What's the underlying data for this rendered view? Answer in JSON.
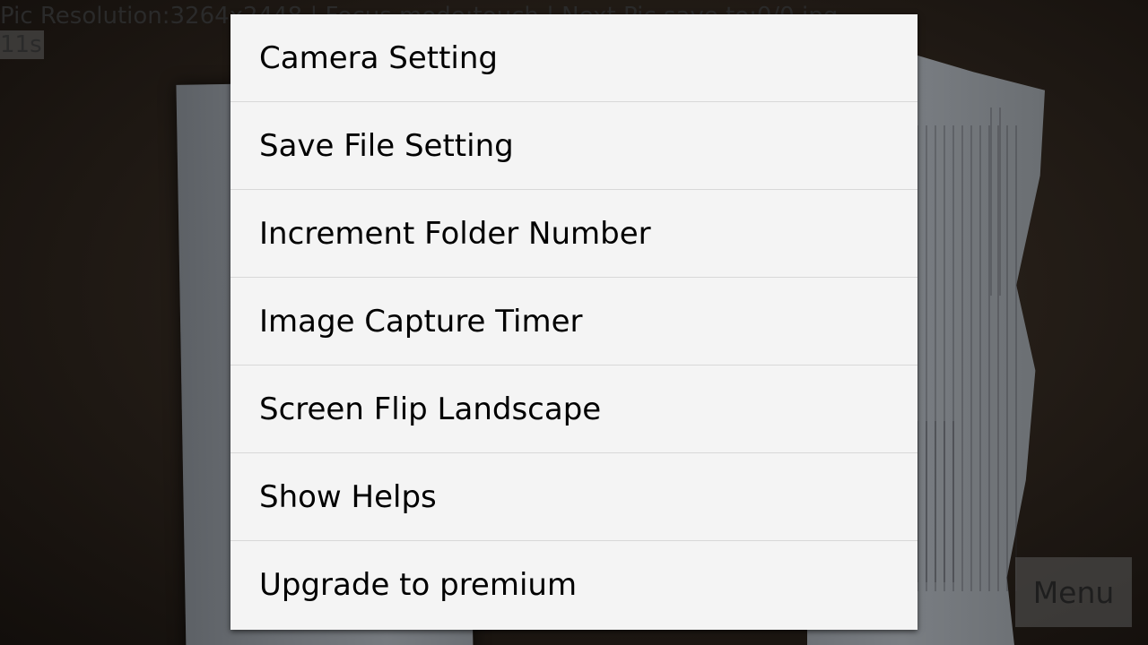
{
  "status": {
    "line1": "Pic Resolution:3264x2448 | Focus mode:touch | Next Pic save to:0/0.jpg",
    "line2": "11s"
  },
  "menu_button": {
    "label": "Menu"
  },
  "options_menu": {
    "items": [
      {
        "label": "Camera Setting"
      },
      {
        "label": "Save File Setting"
      },
      {
        "label": "Increment Folder Number"
      },
      {
        "label": "Image Capture Timer"
      },
      {
        "label": "Screen Flip Landscape"
      },
      {
        "label": "Show Helps"
      },
      {
        "label": "Upgrade to premium"
      }
    ]
  }
}
